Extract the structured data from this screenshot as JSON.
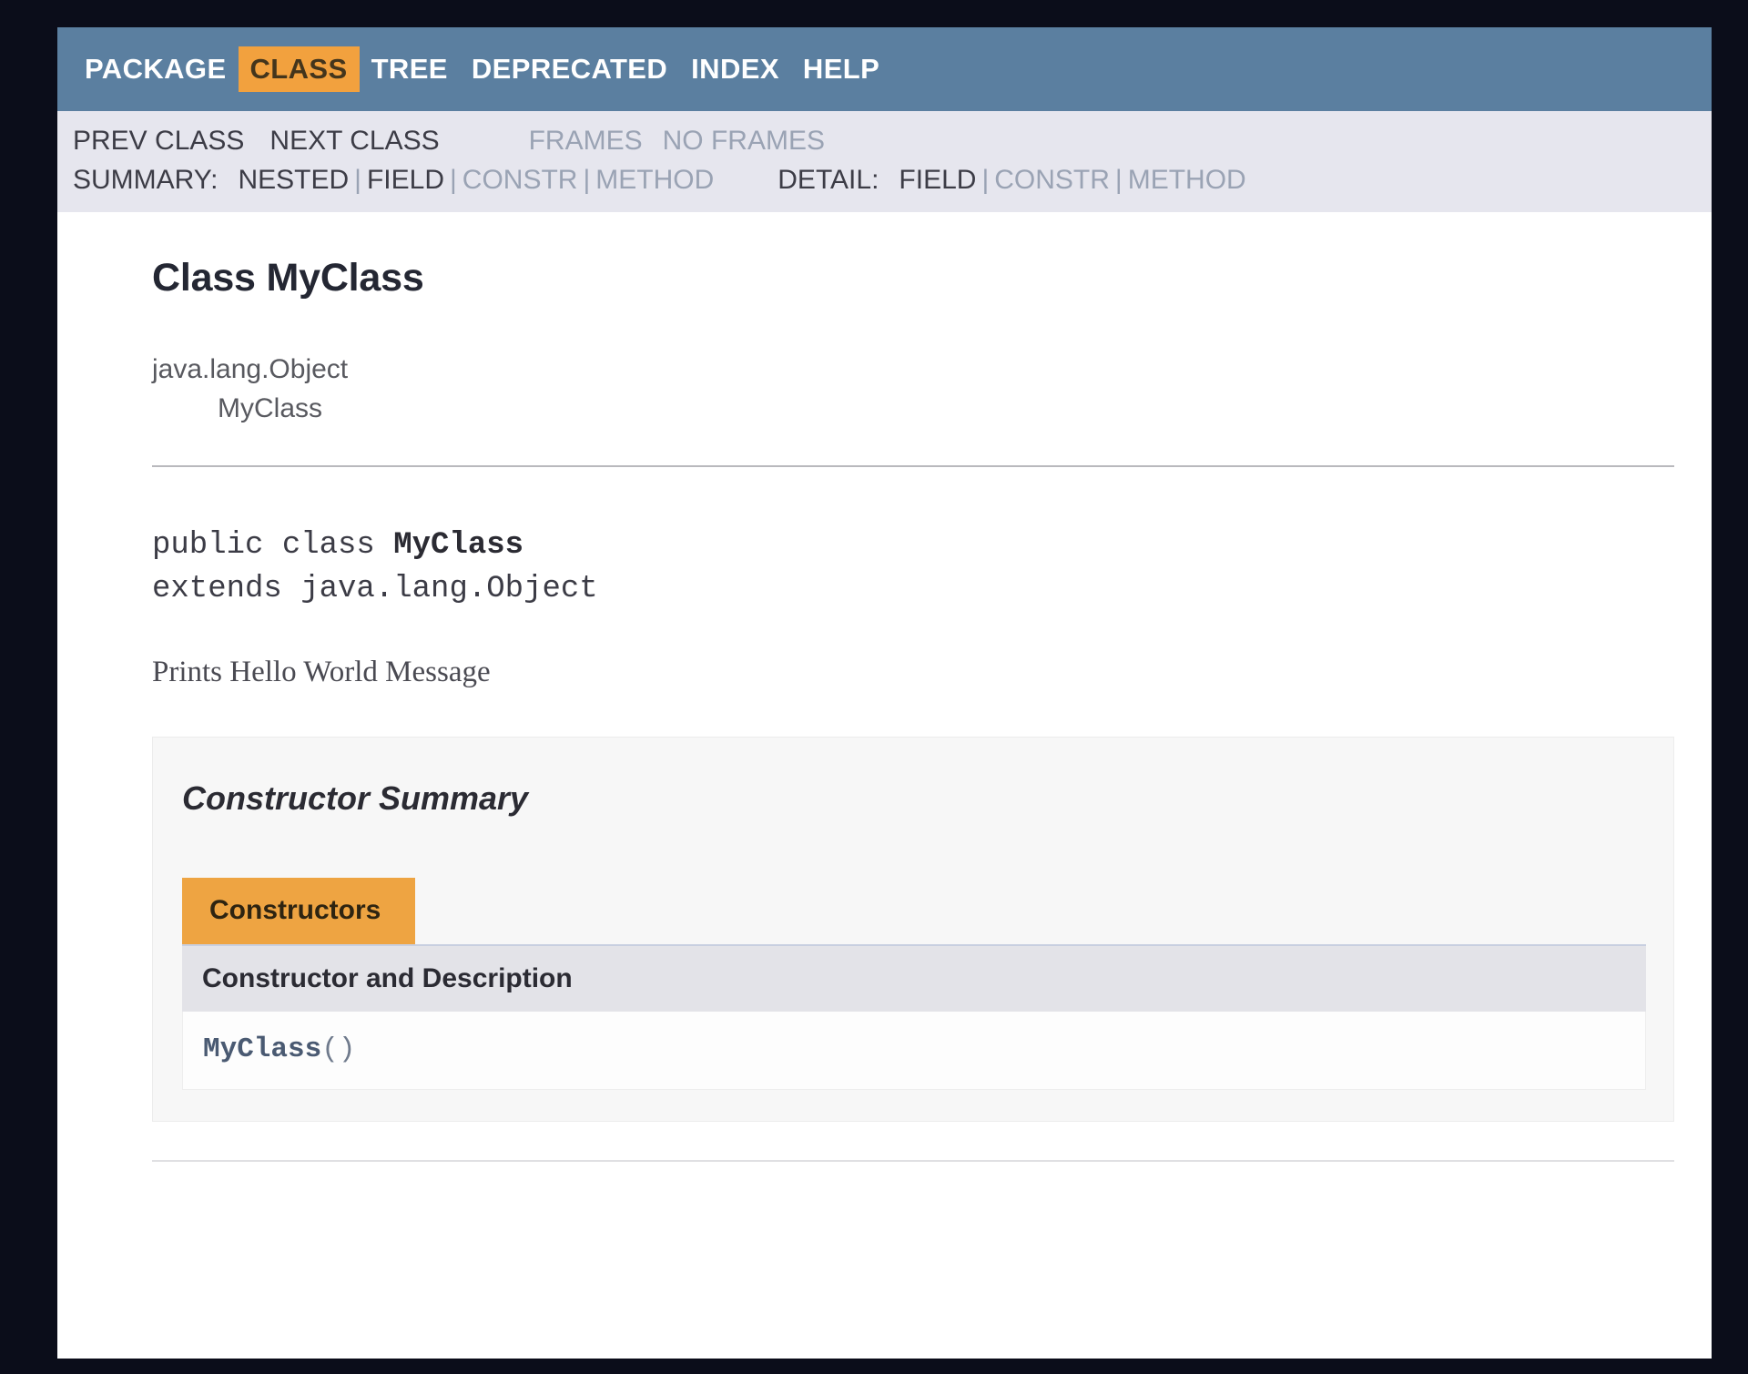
{
  "top_nav": {
    "items": [
      {
        "label": "PACKAGE",
        "active": false
      },
      {
        "label": "CLASS",
        "active": true
      },
      {
        "label": "TREE",
        "active": false
      },
      {
        "label": "DEPRECATED",
        "active": false
      },
      {
        "label": "INDEX",
        "active": false
      },
      {
        "label": "HELP",
        "active": false
      }
    ],
    "active_color": "#f2a13e",
    "bar_color": "#5b7fa0"
  },
  "sub_nav": {
    "row1": {
      "prev_class": "PREV CLASS",
      "next_class": "NEXT CLASS",
      "frames": "FRAMES",
      "no_frames": "NO FRAMES"
    },
    "row2": {
      "summary_label": "SUMMARY:",
      "summary_nested": "NESTED",
      "summary_field": "FIELD",
      "summary_constr": "CONSTR",
      "summary_method": "METHOD",
      "detail_label": "DETAIL:",
      "detail_field": "FIELD",
      "detail_constr": "CONSTR",
      "detail_method": "METHOD",
      "separator": "|"
    }
  },
  "content": {
    "class_title": "Class MyClass",
    "inheritance": {
      "parent": "java.lang.Object",
      "child": "MyClass"
    },
    "declaration": {
      "line1_prefix": "public class ",
      "line1_name": "MyClass",
      "line2": "extends java.lang.Object"
    },
    "description": "Prints Hello World Message"
  },
  "constructor_summary": {
    "heading": "Constructor Summary",
    "tab_label": "Constructors",
    "column_header": "Constructor and Description",
    "rows": [
      {
        "name": "MyClass",
        "parens": "()"
      }
    ]
  }
}
